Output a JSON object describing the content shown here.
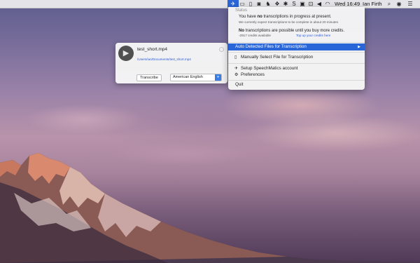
{
  "menubar": {
    "time": "Wed 16:49",
    "user": "Ian Firth",
    "icons": [
      "speechmatics-app-icon",
      "screen-icon",
      "battery-icon",
      "camera-icon",
      "evernote-icon",
      "dropbox-icon",
      "bluetooth-icon",
      "skype-icon",
      "sound-icon",
      "airplay-icon",
      "display-icon",
      "volume-icon",
      "wifi-icon",
      "volume-speaker-icon",
      "spotlight-icon",
      "notification-center-icon"
    ]
  },
  "window": {
    "file_name": "test_short.mp4",
    "file_path": "/Users/ian/Documents/test_short.mp4",
    "transcribe_label": "Transcribe",
    "language_value": "American English"
  },
  "menu": {
    "status_header": "Status",
    "status_line1_pre": "You have ",
    "status_line1_bold": "no",
    "status_line1_post": " transcriptions in progress at present.",
    "status_line2": "We currently expect transcriptions to be complete in about 20 minutes",
    "credits_line1_bold": "No",
    "credits_line1_post": " transcriptions are possible until you buy more credits.",
    "credits_line2": "-2917 credits available",
    "topup_link": "Top up your credits here",
    "items": {
      "auto_detected": "Auto Detected Files for Transcription",
      "manual_select": "Manually Select File for Transcription",
      "setup": "Setup SpeechMatics account",
      "preferences": "Preferences",
      "quit": "Quit"
    }
  }
}
